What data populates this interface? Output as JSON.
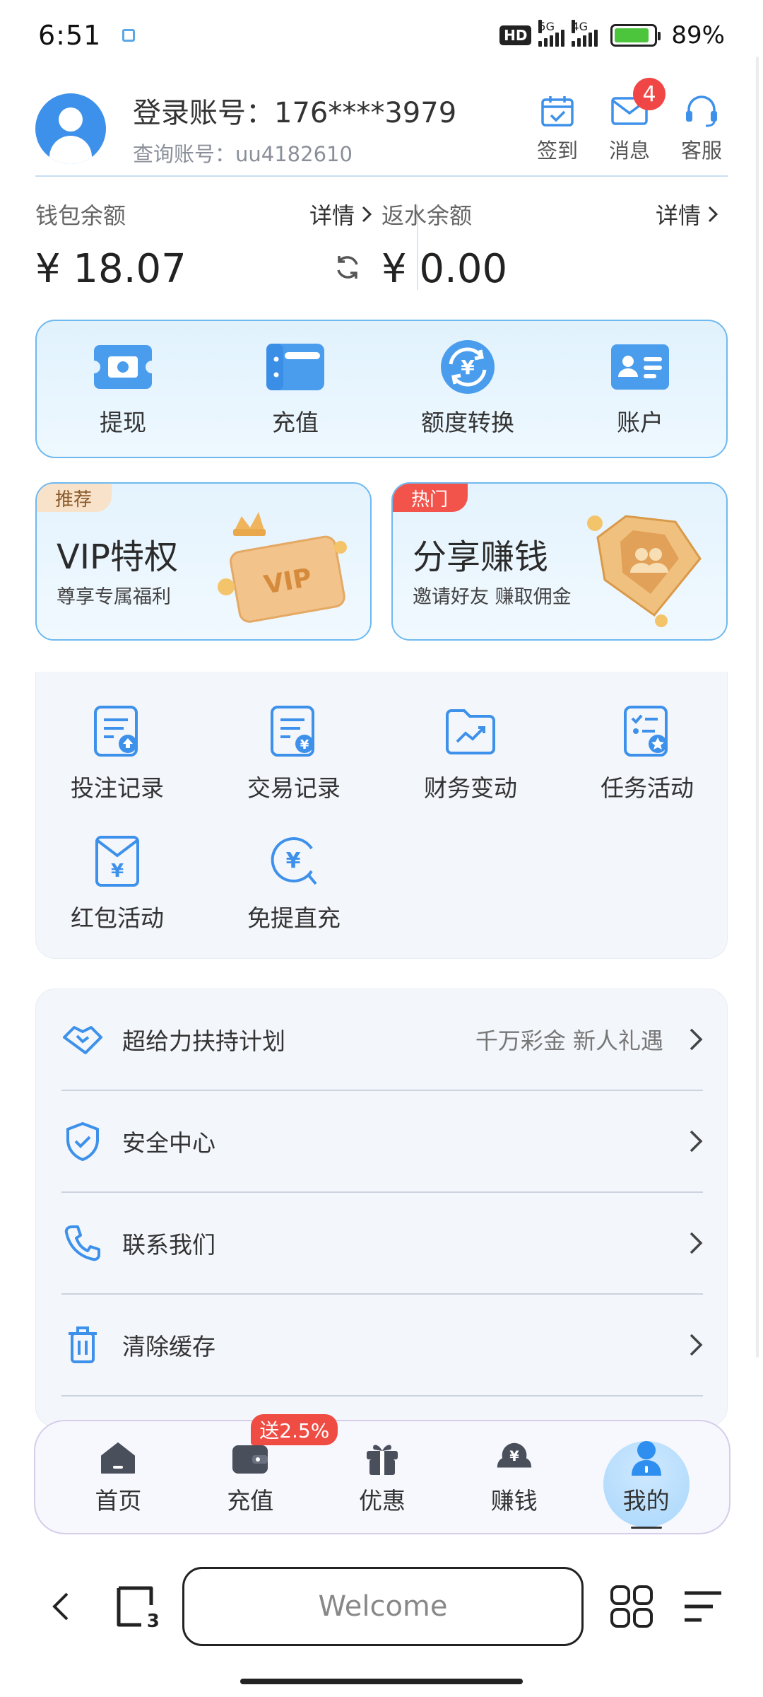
{
  "status_bar": {
    "time": "6:51",
    "hd_label": "HD",
    "net1": "5G",
    "net2": "4G",
    "battery_percent": "89%",
    "battery_level": 0.89
  },
  "header": {
    "login_account_label": "登录账号：176****3979",
    "query_account_label": "查询账号：uu4182610",
    "actions": [
      {
        "label": "签到",
        "icon": "calendar-check-icon"
      },
      {
        "label": "消息",
        "icon": "mail-icon",
        "badge": "4"
      },
      {
        "label": "客服",
        "icon": "headset-icon"
      }
    ]
  },
  "balance": {
    "wallet": {
      "title": "钱包余额",
      "detail": "详情",
      "value": "¥ 18.07"
    },
    "rebate": {
      "title": "返水余额",
      "detail": "详情",
      "value": "¥ 0.00"
    }
  },
  "quick_actions": [
    {
      "label": "提现",
      "icon": "cash-icon"
    },
    {
      "label": "充值",
      "icon": "wallet-icon"
    },
    {
      "label": "额度转换",
      "icon": "exchange-yen-icon"
    },
    {
      "label": "账户",
      "icon": "id-card-icon"
    }
  ],
  "promos": [
    {
      "tag": "推荐",
      "title": "VIP特权",
      "subtitle": "尊享专属福利",
      "icon": "vip-card-icon"
    },
    {
      "tag": "热门",
      "title": "分享赚钱",
      "subtitle": "邀请好友 赚取佣金",
      "icon": "team-gem-icon"
    }
  ],
  "grid_menu": [
    {
      "label": "投注记录",
      "icon": "bet-record-icon"
    },
    {
      "label": "交易记录",
      "icon": "transaction-record-icon"
    },
    {
      "label": "财务变动",
      "icon": "finance-folder-icon"
    },
    {
      "label": "任务活动",
      "icon": "task-icon"
    },
    {
      "label": "红包活动",
      "icon": "red-envelope-icon"
    },
    {
      "label": "免提直充",
      "icon": "direct-recharge-icon"
    }
  ],
  "list_menu": [
    {
      "label": "超给力扶持计划",
      "extra": "千万彩金 新人礼遇",
      "icon": "handshake-icon"
    },
    {
      "label": "安全中心",
      "extra": "",
      "icon": "shield-check-icon"
    },
    {
      "label": "联系我们",
      "extra": "",
      "icon": "phone-icon"
    },
    {
      "label": "清除缓存",
      "extra": "",
      "icon": "trash-icon"
    }
  ],
  "tabbar": [
    {
      "label": "首页",
      "icon": "home-icon"
    },
    {
      "label": "充值",
      "icon": "recharge-icon",
      "badge": "送2.5%"
    },
    {
      "label": "优惠",
      "icon": "gift-icon"
    },
    {
      "label": "赚钱",
      "icon": "earn-icon"
    },
    {
      "label": "我的",
      "icon": "user-icon",
      "active": true
    }
  ],
  "browser": {
    "url_text": "Welcome",
    "tab_count": "3"
  },
  "colors": {
    "accent": "#3e91ea",
    "card_border": "#6fb9f0",
    "badge_red": "#f04646"
  }
}
